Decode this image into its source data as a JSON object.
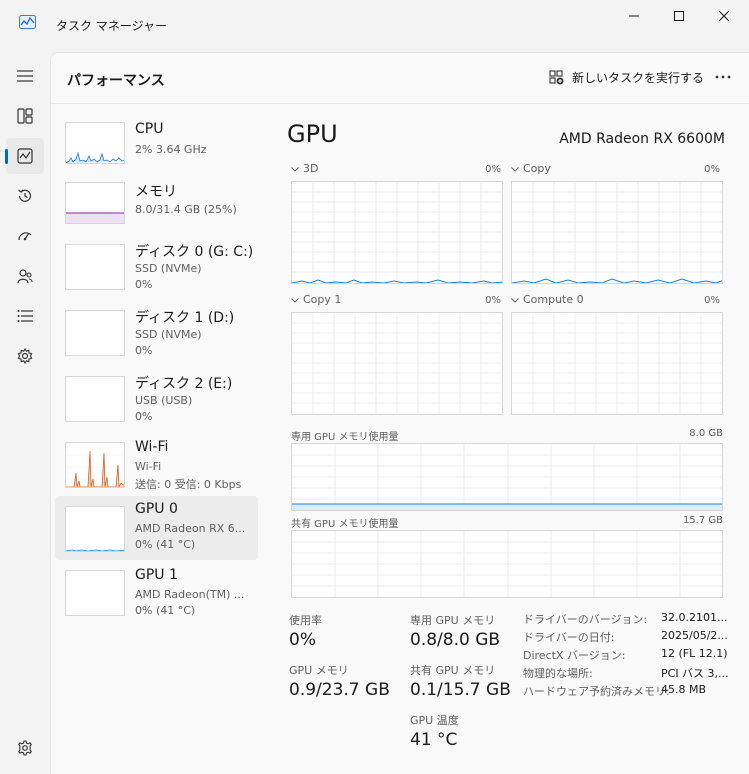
{
  "window": {
    "title": "タスク マネージャー"
  },
  "header": {
    "title": "パフォーマンス",
    "run_task_label": "新しいタスクを実行する"
  },
  "nav": {
    "items": [
      "menu-icon",
      "processes-icon",
      "performance-icon",
      "app-history-icon",
      "startup-icon",
      "users-icon",
      "details-icon",
      "services-icon",
      "settings-icon"
    ],
    "active": "performance"
  },
  "colors": {
    "accent": "#0067c0",
    "cpu": "#1a7fd4",
    "memory": "#8b1fa8",
    "network": "#d35f1e"
  },
  "list": [
    {
      "name": "CPU",
      "sub1": "2%  3.64 GHz",
      "sub2": ""
    },
    {
      "name": "メモリ",
      "sub1": "8.0/31.4 GB (25%)",
      "sub2": ""
    },
    {
      "name": "ディスク 0 (G: C:)",
      "sub1": "SSD (NVMe)",
      "sub2": "0%"
    },
    {
      "name": "ディスク 1 (D:)",
      "sub1": "SSD (NVMe)",
      "sub2": "0%"
    },
    {
      "name": "ディスク 2 (E:)",
      "sub1": "USB (USB)",
      "sub2": "0%"
    },
    {
      "name": "Wi-Fi",
      "sub1": "Wi-Fi",
      "sub2": "送信: 0 受信: 0 Kbps"
    },
    {
      "name": "GPU 0",
      "sub1": "AMD Radeon RX 6...",
      "sub2": "0% (41 °C)"
    },
    {
      "name": "GPU 1",
      "sub1": "AMD Radeon(TM) ...",
      "sub2": "0% (41 °C)"
    }
  ],
  "detail": {
    "title": "GPU",
    "model": "AMD Radeon RX 6600M",
    "engines": [
      {
        "name": "3D",
        "pct": "0%"
      },
      {
        "name": "Copy",
        "pct": "0%"
      },
      {
        "name": "Copy 1",
        "pct": "0%"
      },
      {
        "name": "Compute 0",
        "pct": "0%"
      }
    ],
    "dedicated_mem": {
      "label": "専用 GPU メモリ使用量",
      "max": "8.0 GB"
    },
    "shared_mem": {
      "label": "共有 GPU メモリ使用量",
      "max": "15.7 GB"
    },
    "stats": {
      "utilization": {
        "label": "使用率",
        "value": "0%"
      },
      "dedicated": {
        "label": "専用 GPU メモリ",
        "value": "0.8/8.0 GB"
      },
      "gpu_memory": {
        "label": "GPU メモリ",
        "value": "0.9/23.7 GB"
      },
      "shared": {
        "label": "共有 GPU メモリ",
        "value": "0.1/15.7 GB"
      },
      "temperature": {
        "label": "GPU 温度",
        "value": "41 °C"
      }
    },
    "info": [
      {
        "key": "ドライバーのバージョン:",
        "value": "32.0.2101..."
      },
      {
        "key": "ドライバーの日付:",
        "value": "2025/05/2..."
      },
      {
        "key": "DirectX バージョン:",
        "value": "12 (FL 12.1)"
      },
      {
        "key": "物理的な場所:",
        "value": "PCI バス 3,..."
      },
      {
        "key": "ハードウェア予約済みメモリ:",
        "value": "45.8 MB"
      }
    ]
  }
}
